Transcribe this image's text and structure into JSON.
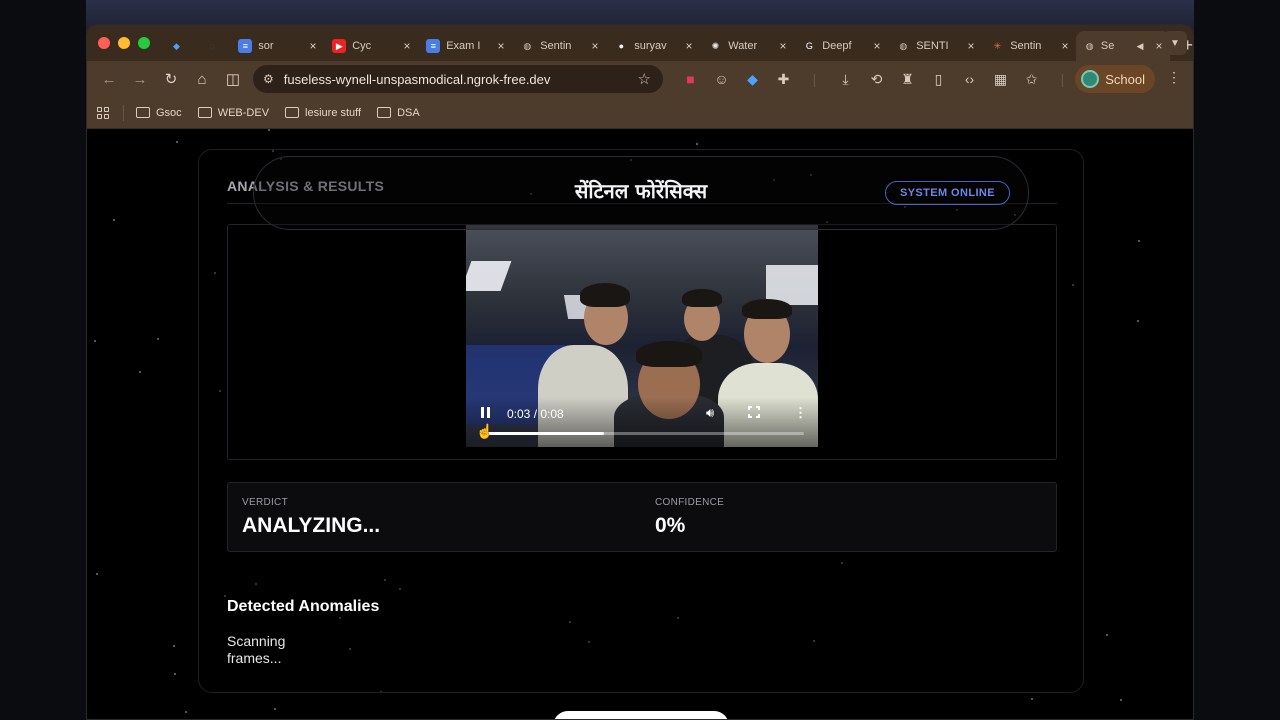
{
  "browser": {
    "tabs": [
      {
        "label": "",
        "icon": "gem-icon",
        "pinned": true
      },
      {
        "label": "",
        "icon": "chat-icon",
        "pinned": true
      },
      {
        "label": "sor",
        "icon": "docs-icon"
      },
      {
        "label": "Cyc",
        "icon": "youtube-icon"
      },
      {
        "label": "Exam I",
        "icon": "docs-icon"
      },
      {
        "label": "Sentin",
        "icon": "globe-icon"
      },
      {
        "label": "suryav",
        "icon": "github-icon"
      },
      {
        "label": "Water",
        "icon": "openai-icon"
      },
      {
        "label": "Deepf",
        "icon": "google-icon"
      },
      {
        "label": "SENTI",
        "icon": "globe-icon"
      },
      {
        "label": "Sentin",
        "icon": "claude-icon"
      },
      {
        "label": "Se",
        "icon": "globe-icon",
        "active": true
      }
    ],
    "url": "fuseless-wynell-unspasmodical.ngrok-free.dev",
    "profile_label": "School",
    "bookmarks": [
      "Gsoc",
      "WEB-DEV",
      "lesiure stuff",
      "DSA"
    ]
  },
  "app": {
    "brand": "सेंटिनल फोरेंसिक्स",
    "status": "SYSTEM ONLINE",
    "panel_title": "ANALYSIS & RESULTS",
    "video": {
      "time": "0:03 / 0:08",
      "progress_fraction": 0.375
    },
    "verdict_label": "VERDICT",
    "verdict_value": "ANALYZING...",
    "confidence_label": "CONFIDENCE",
    "confidence_value": "0%",
    "anomalies_title": "Detected Anomalies",
    "anomalies_text": "Scanning frames..."
  },
  "colors": {
    "accent": "#4a61c4",
    "tab_bar": "#3a2b1f",
    "toolbar": "#4d3b2c",
    "page_bg": "#000000"
  }
}
